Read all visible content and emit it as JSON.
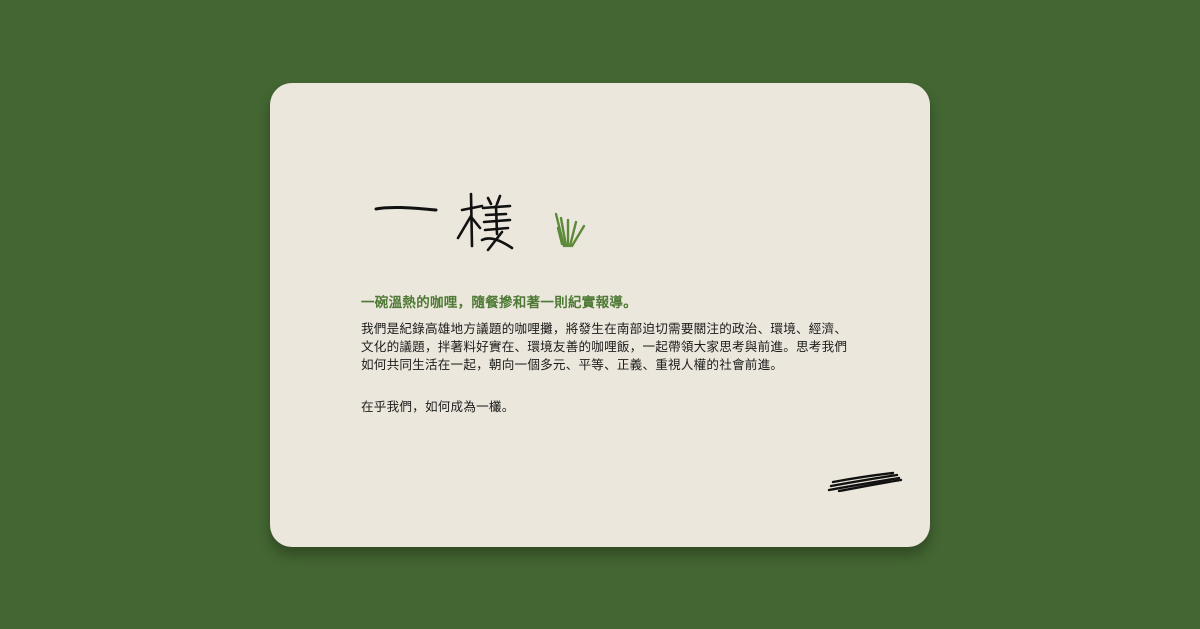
{
  "brand": {
    "logo_text": "一欉",
    "accent_color": "#4f7a35",
    "background_color": "#436632",
    "card_color": "#ece7dc"
  },
  "content": {
    "tagline": "一碗溫熱的咖哩，隨餐摻和著一則紀實報導。",
    "description": "我們是紀錄高雄地方議題的咖哩攤，將發生在南部迫切需要關注的政治、環境、經濟、文化的議題，拌著料好實在、環境友善的咖哩飯，一起帶領大家思考與前進。思考我們如何共同生活在一起，朝向一個多元、平等、正義、重視人權的社會前進。",
    "closing": "在乎我們，如何成為一欉。"
  },
  "icons": {
    "logo_mark": "grass-sprig-icon",
    "decoration": "scribble-lines-icon"
  }
}
